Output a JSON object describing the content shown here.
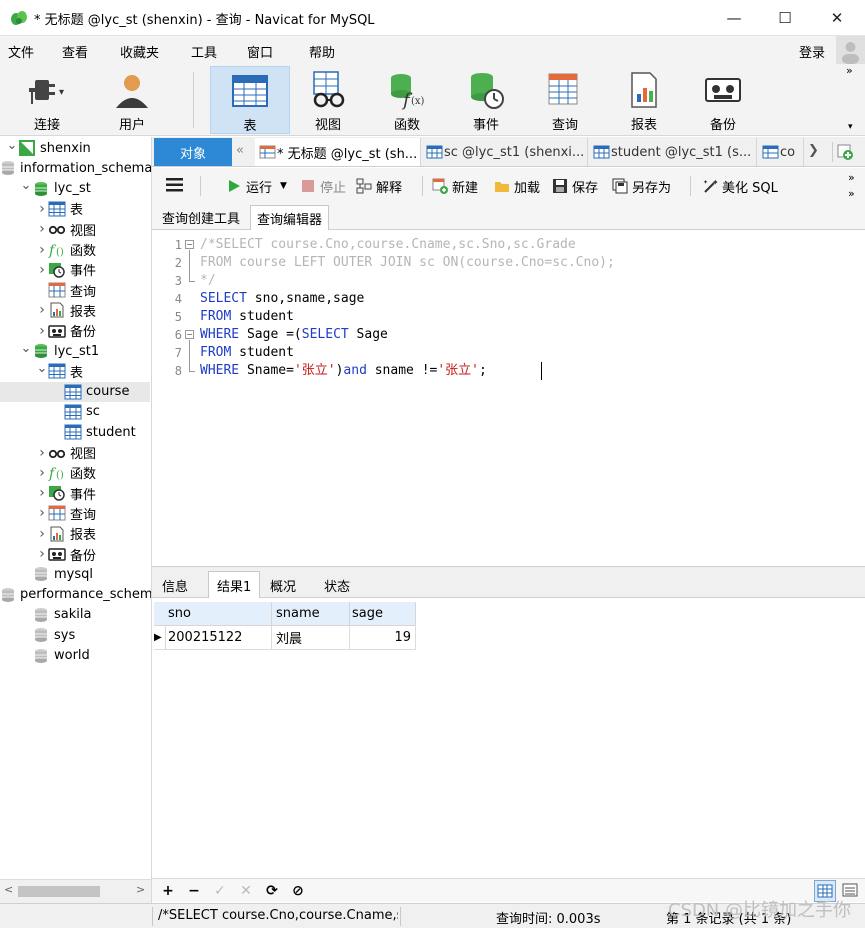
{
  "window": {
    "title": "* 无标题 @lyc_st (shenxin) - 查询 - Navicat for MySQL",
    "minimize": "—",
    "maximize": "☐",
    "close": "✕"
  },
  "menu": {
    "items": [
      "文件",
      "查看",
      "收藏夹",
      "工具",
      "窗口",
      "帮助"
    ],
    "login": "登录"
  },
  "toolbar": {
    "buttons": [
      {
        "label": "连接",
        "icon": "plug-icon"
      },
      {
        "label": "用户",
        "icon": "user-icon"
      },
      {
        "label": "表",
        "icon": "table-icon"
      },
      {
        "label": "视图",
        "icon": "view-glasses-icon"
      },
      {
        "label": "函数",
        "icon": "function-icon"
      },
      {
        "label": "事件",
        "icon": "event-clock-icon"
      },
      {
        "label": "查询",
        "icon": "query-icon"
      },
      {
        "label": "报表",
        "icon": "report-icon"
      },
      {
        "label": "备份",
        "icon": "backup-tape-icon"
      }
    ],
    "active": "表"
  },
  "nav": {
    "tree": [
      {
        "label": "shenxin",
        "level": 0,
        "arrow": "down",
        "icon": "connection-icon"
      },
      {
        "label": "information_schema",
        "level": 1,
        "icon": "db-grey-icon"
      },
      {
        "label": "lyc_st",
        "level": 1,
        "arrow": "down",
        "icon": "db-green-icon"
      },
      {
        "label": "表",
        "level": 2,
        "arrow": "right",
        "icon": "table-icon"
      },
      {
        "label": "视图",
        "level": 2,
        "arrow": "right",
        "icon": "view-glasses-icon"
      },
      {
        "label": "函数",
        "level": 2,
        "arrow": "right",
        "icon": "function-icon"
      },
      {
        "label": "事件",
        "level": 2,
        "arrow": "right",
        "icon": "event-clock-icon"
      },
      {
        "label": "查询",
        "level": 2,
        "icon": "query-icon"
      },
      {
        "label": "报表",
        "level": 2,
        "arrow": "right",
        "icon": "report-icon"
      },
      {
        "label": "备份",
        "level": 2,
        "arrow": "right",
        "icon": "backup-tape-icon"
      },
      {
        "label": "lyc_st1",
        "level": 1,
        "arrow": "down",
        "icon": "db-green-icon"
      },
      {
        "label": "表",
        "level": 2,
        "arrow": "down",
        "icon": "table-icon"
      },
      {
        "label": "course",
        "level": 3,
        "icon": "table-icon",
        "selected": true
      },
      {
        "label": "sc",
        "level": 3,
        "icon": "table-icon"
      },
      {
        "label": "student",
        "level": 3,
        "icon": "table-icon"
      },
      {
        "label": "视图",
        "level": 2,
        "arrow": "right",
        "icon": "view-glasses-icon"
      },
      {
        "label": "函数",
        "level": 2,
        "arrow": "right",
        "icon": "function-icon"
      },
      {
        "label": "事件",
        "level": 2,
        "arrow": "right",
        "icon": "event-clock-icon"
      },
      {
        "label": "查询",
        "level": 2,
        "arrow": "right",
        "icon": "query-icon"
      },
      {
        "label": "报表",
        "level": 2,
        "arrow": "right",
        "icon": "report-icon"
      },
      {
        "label": "备份",
        "level": 2,
        "arrow": "right",
        "icon": "backup-tape-icon"
      },
      {
        "label": "mysql",
        "level": 1,
        "icon": "db-grey-icon"
      },
      {
        "label": "performance_schema",
        "level": 1,
        "icon": "db-grey-icon"
      },
      {
        "label": "sakila",
        "level": 1,
        "icon": "db-grey-icon"
      },
      {
        "label": "sys",
        "level": 1,
        "icon": "db-grey-icon"
      },
      {
        "label": "world",
        "level": 1,
        "icon": "db-grey-icon"
      }
    ]
  },
  "tabs": {
    "objects": "对象",
    "items": [
      {
        "label": "* 无标题 @lyc_st (sh...",
        "active": true
      },
      {
        "label": "sc @lyc_st1 (shenxi..."
      },
      {
        "label": "student @lyc_st1 (s..."
      },
      {
        "label": "co"
      }
    ]
  },
  "query_toolbar": {
    "run": "运行",
    "stop": "停止",
    "explain": "解释",
    "new": "新建",
    "load": "加载",
    "save": "保存",
    "save_as": "另存为",
    "beautify": "美化 SQL"
  },
  "subtabs": [
    "查询创建工具",
    "查询编辑器"
  ],
  "editor": {
    "lines": [
      {
        "n": "1",
        "parts": [
          {
            "t": "/*SELECT course.Cno,course.Cname,sc.Sno,sc.Grade",
            "c": "cm"
          }
        ]
      },
      {
        "n": "2",
        "parts": [
          {
            "t": "FROM course LEFT OUTER JOIN sc ON(course.Cno=sc.Cno);",
            "c": "cm"
          }
        ]
      },
      {
        "n": "3",
        "parts": [
          {
            "t": "*/",
            "c": "cm"
          }
        ]
      },
      {
        "n": "4",
        "parts": [
          {
            "t": "SELECT",
            "c": "kw"
          },
          {
            "t": " sno,sname,sage",
            "c": ""
          }
        ]
      },
      {
        "n": "5",
        "parts": [
          {
            "t": "FROM",
            "c": "kw"
          },
          {
            "t": " student",
            "c": ""
          }
        ]
      },
      {
        "n": "6",
        "parts": [
          {
            "t": "WHERE",
            "c": "kw"
          },
          {
            "t": " Sage =(",
            "c": ""
          },
          {
            "t": "SELECT",
            "c": "kw"
          },
          {
            "t": " Sage",
            "c": ""
          }
        ]
      },
      {
        "n": "7",
        "parts": [
          {
            "t": "FROM",
            "c": "kw"
          },
          {
            "t": " student",
            "c": ""
          }
        ]
      },
      {
        "n": "8",
        "parts": [
          {
            "t": "WHERE",
            "c": "kw"
          },
          {
            "t": " Sname=",
            "c": ""
          },
          {
            "t": "'张立'",
            "c": "str"
          },
          {
            "t": ")",
            "c": ""
          },
          {
            "t": "and",
            "c": "kw"
          },
          {
            "t": " sname !=",
            "c": ""
          },
          {
            "t": "'张立'",
            "c": "str"
          },
          {
            "t": ";",
            "c": ""
          }
        ]
      }
    ]
  },
  "result_tabs": [
    "信息",
    "结果1",
    "概况",
    "状态"
  ],
  "grid": {
    "columns": [
      "sno",
      "sname",
      "sage"
    ],
    "rows": [
      [
        "200215122",
        "刘晨",
        "19"
      ]
    ]
  },
  "status": {
    "sql": "/*SELECT course.Cno,course.Cname,s",
    "time": "查询时间: 0.003s",
    "records": "第 1 条记录 (共 1 条)"
  },
  "watermark": "CSDN @比镜加之手你"
}
